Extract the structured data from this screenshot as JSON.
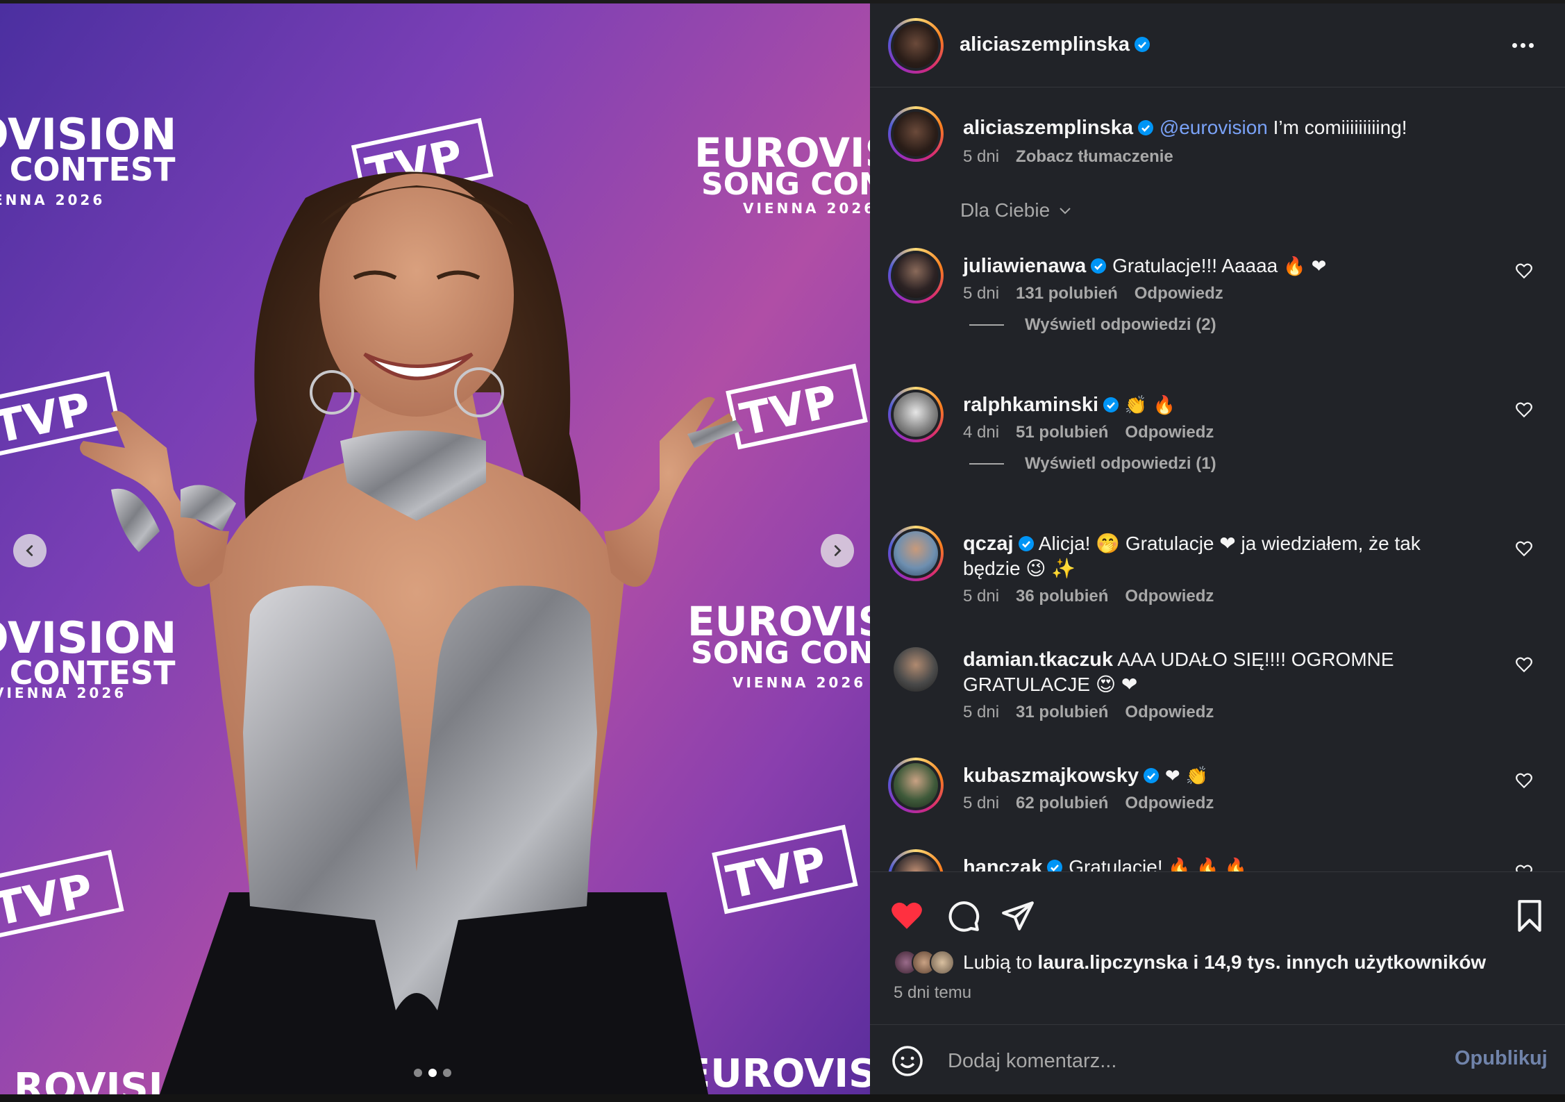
{
  "media": {
    "logo_lines": [
      "EUROVISION",
      "SONG CONTEST",
      "VIENNA 2026"
    ],
    "broadcaster": "TVP",
    "slide_index": 2,
    "slide_count": 3
  },
  "post": {
    "author": "aliciaszemplinska",
    "caption_mention": "@eurovision",
    "caption_text": "I’m comiiiiiiiiing!",
    "caption_time": "5 dni",
    "translate_label": "Zobacz tłumaczenie"
  },
  "comments_filter": "Dla Ciebie",
  "comments": [
    {
      "user": "juliawienawa",
      "text": "Gratulacje!!! Aaaaa",
      "emoji": "🔥 ❤",
      "time": "5 dni",
      "likes": "131 polubień",
      "reply": "Odpowiedz",
      "replies_label": "Wyświetl odpowiedzi (2)"
    },
    {
      "user": "ralphkaminski",
      "text": "",
      "emoji": "👏 🔥",
      "time": "4 dni",
      "likes": "51 polubień",
      "reply": "Odpowiedz",
      "replies_label": "Wyświetl odpowiedzi (1)"
    },
    {
      "user": "qczaj",
      "text": "Alicja! 🤭 Gratulacje ❤ ja wiedziałem, że tak",
      "text2": "będzie 😉 ✨",
      "time": "5 dni",
      "likes": "36 polubień",
      "reply": "Odpowiedz"
    },
    {
      "user": "damian.tkaczuk",
      "text": "AAA UDAŁO SIĘ!!!! OGROMNE",
      "text2": "GRATULACJE 😍 ❤",
      "time": "5 dni",
      "likes": "31 polubień",
      "reply": "Odpowiedz"
    },
    {
      "user": "kubaszmajkowsky",
      "text": "",
      "emoji": "❤ 👏",
      "time": "5 dni",
      "likes": "62 polubień",
      "reply": "Odpowiedz"
    },
    {
      "user": "hanczak",
      "text": "Gratulacje!",
      "emoji": "🔥 🔥 🔥"
    }
  ],
  "likes": {
    "prefix": "Lubią to",
    "user": "laura.lipczynska",
    "suffix": "i 14,9 tys. innych użytkowników",
    "time": "5 dni temu"
  },
  "comment_box": {
    "placeholder": "Dodaj komentarz...",
    "publish_label": "Opublikuj"
  },
  "colors": {
    "panel_bg": "#212328",
    "liked_heart": "#ff3040",
    "verified": "#0095f6",
    "mention": "#7aa2f7"
  }
}
